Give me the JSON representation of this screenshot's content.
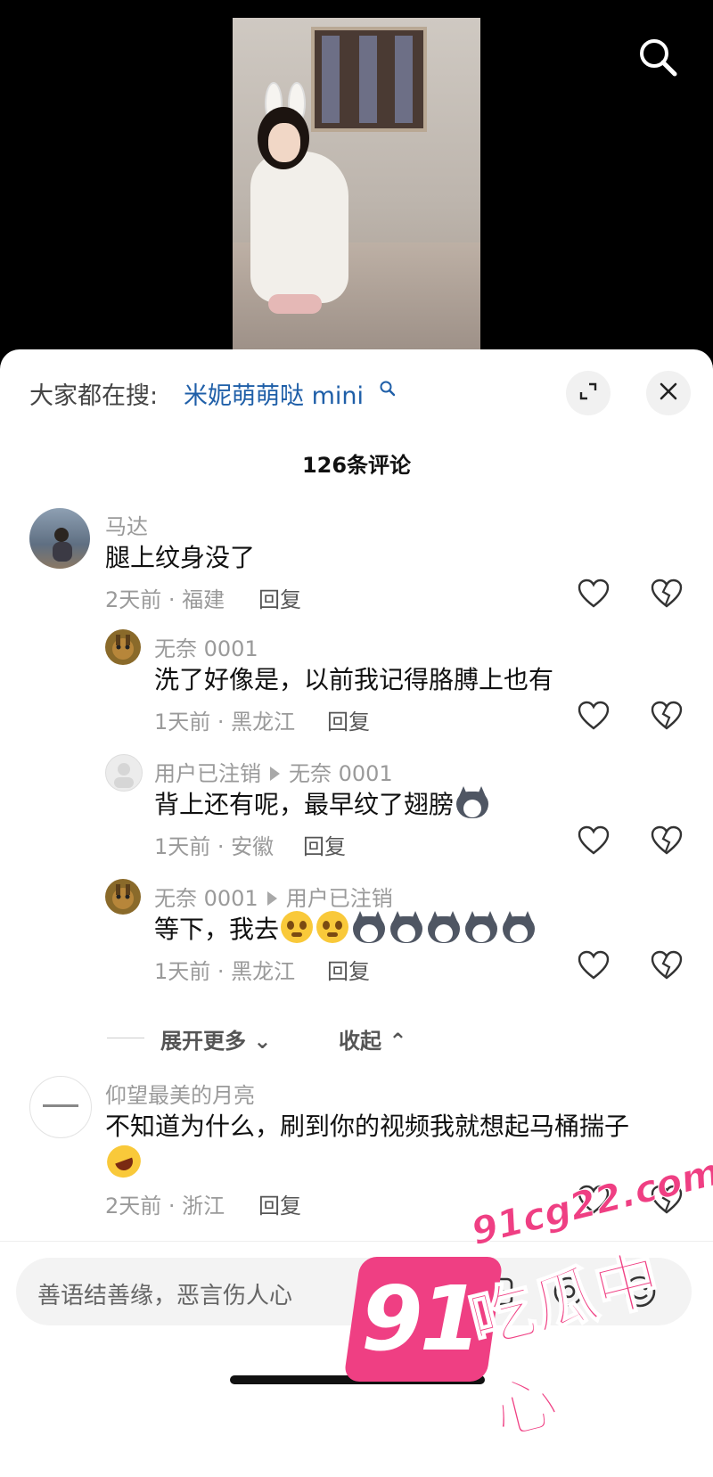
{
  "header": {
    "search_prefix": "大家都在搜:",
    "search_keyword": "米妮萌萌哒 mini",
    "comment_count": "126条评论"
  },
  "icons": {
    "top_search": "search-icon",
    "keyword_search": "search-icon",
    "expand": "expand-icon",
    "close": "close-icon",
    "like": "heart-icon",
    "dislike": "broken-heart-icon"
  },
  "comments": [
    {
      "username": "马达",
      "content": "腿上纹身没了",
      "meta": "2天前 · 福建",
      "reply": "回复"
    },
    {
      "username": "无奈 0001",
      "content": "洗了好像是，以前我记得胳膊上也有",
      "meta": "1天前 · 黑龙江",
      "reply": "回复"
    },
    {
      "username": "用户已注销",
      "reply_to": "无奈 0001",
      "content": "背上还有呢，最早纹了翅膀",
      "meta": "1天前 · 安徽",
      "reply": "回复"
    },
    {
      "username": "无奈 0001",
      "reply_to": "用户已注销",
      "content": "等下，我去",
      "meta": "1天前 · 黑龙江",
      "reply": "回复"
    },
    {
      "username": "仰望最美的月亮",
      "content": "不知道为什么，刷到你的视频我就想起马桶揣子",
      "meta": "2天前 · 浙江",
      "reply": "回复"
    }
  ],
  "thread_controls": {
    "expand_more": "展开更多",
    "collapse": "收起"
  },
  "input": {
    "placeholder": "善语结善缘，恶言伤人心"
  },
  "watermark": {
    "number": "91",
    "domain": "91cg22.com",
    "name": "吃瓜中心"
  },
  "colors": {
    "keyword_blue": "#1f5fa8",
    "watermark_pink": "#ef3f83"
  }
}
